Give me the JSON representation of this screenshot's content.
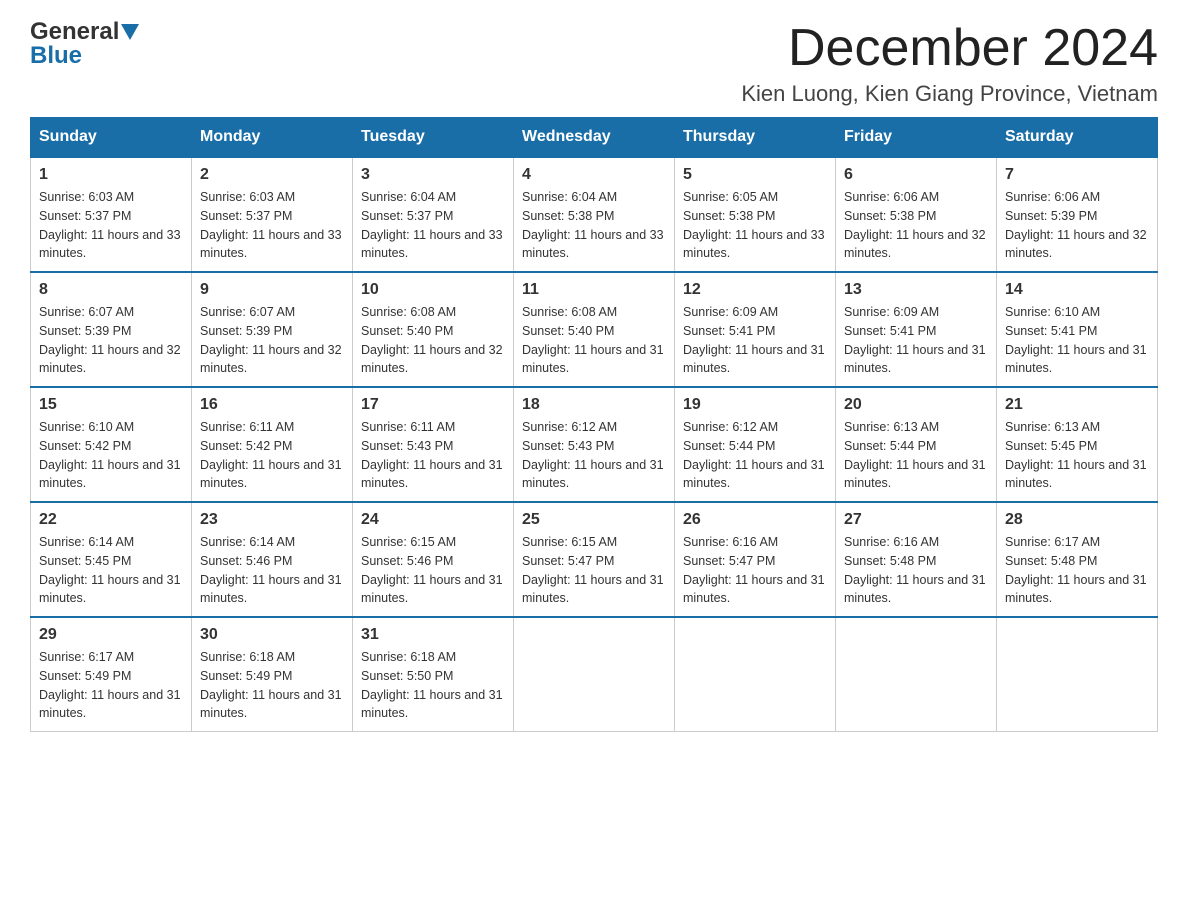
{
  "header": {
    "logo_general": "General",
    "logo_blue": "Blue",
    "month_title": "December 2024",
    "location": "Kien Luong, Kien Giang Province, Vietnam"
  },
  "days_of_week": [
    "Sunday",
    "Monday",
    "Tuesday",
    "Wednesday",
    "Thursday",
    "Friday",
    "Saturday"
  ],
  "weeks": [
    [
      {
        "day": "1",
        "sunrise": "6:03 AM",
        "sunset": "5:37 PM",
        "daylight": "11 hours and 33 minutes."
      },
      {
        "day": "2",
        "sunrise": "6:03 AM",
        "sunset": "5:37 PM",
        "daylight": "11 hours and 33 minutes."
      },
      {
        "day": "3",
        "sunrise": "6:04 AM",
        "sunset": "5:37 PM",
        "daylight": "11 hours and 33 minutes."
      },
      {
        "day": "4",
        "sunrise": "6:04 AM",
        "sunset": "5:38 PM",
        "daylight": "11 hours and 33 minutes."
      },
      {
        "day": "5",
        "sunrise": "6:05 AM",
        "sunset": "5:38 PM",
        "daylight": "11 hours and 33 minutes."
      },
      {
        "day": "6",
        "sunrise": "6:06 AM",
        "sunset": "5:38 PM",
        "daylight": "11 hours and 32 minutes."
      },
      {
        "day": "7",
        "sunrise": "6:06 AM",
        "sunset": "5:39 PM",
        "daylight": "11 hours and 32 minutes."
      }
    ],
    [
      {
        "day": "8",
        "sunrise": "6:07 AM",
        "sunset": "5:39 PM",
        "daylight": "11 hours and 32 minutes."
      },
      {
        "day": "9",
        "sunrise": "6:07 AM",
        "sunset": "5:39 PM",
        "daylight": "11 hours and 32 minutes."
      },
      {
        "day": "10",
        "sunrise": "6:08 AM",
        "sunset": "5:40 PM",
        "daylight": "11 hours and 32 minutes."
      },
      {
        "day": "11",
        "sunrise": "6:08 AM",
        "sunset": "5:40 PM",
        "daylight": "11 hours and 31 minutes."
      },
      {
        "day": "12",
        "sunrise": "6:09 AM",
        "sunset": "5:41 PM",
        "daylight": "11 hours and 31 minutes."
      },
      {
        "day": "13",
        "sunrise": "6:09 AM",
        "sunset": "5:41 PM",
        "daylight": "11 hours and 31 minutes."
      },
      {
        "day": "14",
        "sunrise": "6:10 AM",
        "sunset": "5:41 PM",
        "daylight": "11 hours and 31 minutes."
      }
    ],
    [
      {
        "day": "15",
        "sunrise": "6:10 AM",
        "sunset": "5:42 PM",
        "daylight": "11 hours and 31 minutes."
      },
      {
        "day": "16",
        "sunrise": "6:11 AM",
        "sunset": "5:42 PM",
        "daylight": "11 hours and 31 minutes."
      },
      {
        "day": "17",
        "sunrise": "6:11 AM",
        "sunset": "5:43 PM",
        "daylight": "11 hours and 31 minutes."
      },
      {
        "day": "18",
        "sunrise": "6:12 AM",
        "sunset": "5:43 PM",
        "daylight": "11 hours and 31 minutes."
      },
      {
        "day": "19",
        "sunrise": "6:12 AM",
        "sunset": "5:44 PM",
        "daylight": "11 hours and 31 minutes."
      },
      {
        "day": "20",
        "sunrise": "6:13 AM",
        "sunset": "5:44 PM",
        "daylight": "11 hours and 31 minutes."
      },
      {
        "day": "21",
        "sunrise": "6:13 AM",
        "sunset": "5:45 PM",
        "daylight": "11 hours and 31 minutes."
      }
    ],
    [
      {
        "day": "22",
        "sunrise": "6:14 AM",
        "sunset": "5:45 PM",
        "daylight": "11 hours and 31 minutes."
      },
      {
        "day": "23",
        "sunrise": "6:14 AM",
        "sunset": "5:46 PM",
        "daylight": "11 hours and 31 minutes."
      },
      {
        "day": "24",
        "sunrise": "6:15 AM",
        "sunset": "5:46 PM",
        "daylight": "11 hours and 31 minutes."
      },
      {
        "day": "25",
        "sunrise": "6:15 AM",
        "sunset": "5:47 PM",
        "daylight": "11 hours and 31 minutes."
      },
      {
        "day": "26",
        "sunrise": "6:16 AM",
        "sunset": "5:47 PM",
        "daylight": "11 hours and 31 minutes."
      },
      {
        "day": "27",
        "sunrise": "6:16 AM",
        "sunset": "5:48 PM",
        "daylight": "11 hours and 31 minutes."
      },
      {
        "day": "28",
        "sunrise": "6:17 AM",
        "sunset": "5:48 PM",
        "daylight": "11 hours and 31 minutes."
      }
    ],
    [
      {
        "day": "29",
        "sunrise": "6:17 AM",
        "sunset": "5:49 PM",
        "daylight": "11 hours and 31 minutes."
      },
      {
        "day": "30",
        "sunrise": "6:18 AM",
        "sunset": "5:49 PM",
        "daylight": "11 hours and 31 minutes."
      },
      {
        "day": "31",
        "sunrise": "6:18 AM",
        "sunset": "5:50 PM",
        "daylight": "11 hours and 31 minutes."
      },
      null,
      null,
      null,
      null
    ]
  ],
  "labels": {
    "sunrise": "Sunrise: ",
    "sunset": "Sunset: ",
    "daylight": "Daylight: "
  },
  "colors": {
    "header_bg": "#1a6ea8",
    "border": "#1a6ea8",
    "text": "#333"
  }
}
